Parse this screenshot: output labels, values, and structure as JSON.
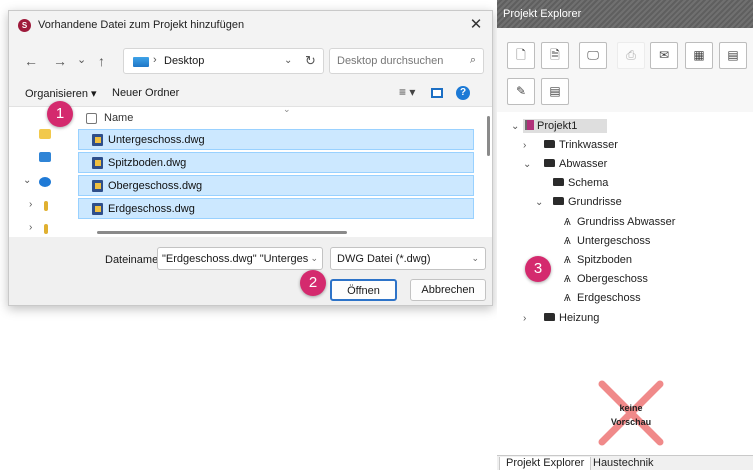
{
  "dialog": {
    "title": "Vorhandene Datei zum Projekt hinzufügen",
    "app_icon": "S",
    "close": "✕",
    "nav": {
      "back": "←",
      "forward": "→",
      "history": "⌄",
      "up": "↑"
    },
    "address": {
      "chevron": "›",
      "path": "Desktop",
      "dropdown": "⌄",
      "refresh": "↻"
    },
    "search": {
      "placeholder": "Desktop durchsuchen",
      "icon": "⌕"
    },
    "toolbar": {
      "organize": "Organisieren ▾",
      "new_folder": "Neuer Ordner",
      "view": "≡ ▾",
      "help": "?"
    },
    "left_pane": {
      "chevrons": [
        "⌄",
        "›",
        "›"
      ]
    },
    "column_header": {
      "name": "Name",
      "sort_indicator": "⌄"
    },
    "files": [
      {
        "name": "Untergeschoss.dwg"
      },
      {
        "name": "Spitzboden.dwg"
      },
      {
        "name": "Obergeschoss.dwg"
      },
      {
        "name": "Erdgeschoss.dwg"
      }
    ],
    "filename_label": "Dateiname:",
    "filename_value": "\"Erdgeschoss.dwg\" \"Untergeschoss.",
    "filename_dropdown": "⌄",
    "filetype_value": "DWG Datei (*.dwg)",
    "filetype_dropdown": "⌄",
    "open_button": "Öffnen",
    "cancel_button": "Abbrechen"
  },
  "markers": [
    "1",
    "2",
    "3"
  ],
  "explorer": {
    "title": "Projekt Explorer",
    "tools_row1": [
      "🗋",
      "🗎",
      "🖵",
      "⎙",
      "✉",
      "▦",
      "▤"
    ],
    "tools_row2": [
      "✎",
      "▤"
    ],
    "tree": [
      {
        "label": "Projekt1",
        "chevron": "⌄"
      },
      {
        "label": "Trinkwasser",
        "chevron": "›"
      },
      {
        "label": "Abwasser",
        "chevron": "⌄"
      },
      {
        "label": "Schema",
        "chevron": ""
      },
      {
        "label": "Grundrisse",
        "chevron": "⌄"
      },
      {
        "label": "Grundriss Abwasser",
        "chevron": ""
      },
      {
        "label": "Untergeschoss",
        "chevron": ""
      },
      {
        "label": "Spitzboden",
        "chevron": ""
      },
      {
        "label": "Obergeschoss",
        "chevron": ""
      },
      {
        "label": "Erdgeschoss",
        "chevron": ""
      },
      {
        "label": "Heizung",
        "chevron": "›"
      }
    ],
    "plan_glyph": "Ѧ",
    "preview": {
      "line1": "keine",
      "line2": "Vorschau"
    },
    "tabs": [
      "Projekt Explorer",
      "Haustechnik"
    ]
  },
  "colors": {
    "accent": "#2d73c8",
    "selection": "#cce8ff",
    "marker": "#d42a6e",
    "cross": "#f08a8a"
  }
}
